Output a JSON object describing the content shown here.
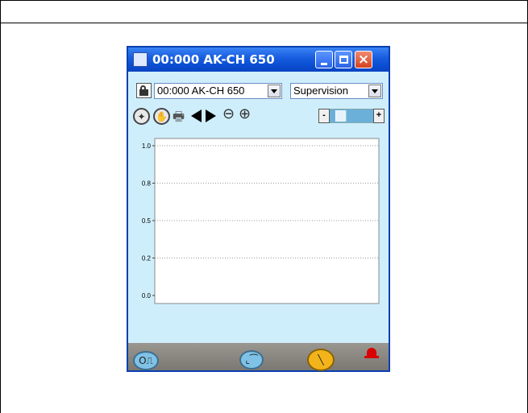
{
  "window": {
    "title": "00:000 AK-CH 650",
    "icon": "trend-window-icon",
    "controls": [
      "minimize-icon",
      "maximize-icon",
      "close-icon"
    ]
  },
  "selectors": {
    "device": {
      "value": "00:000 AK-CH 650"
    },
    "mode": {
      "value": "Supervision"
    }
  },
  "toolbar": {
    "icons": [
      "auto-scale-icon",
      "pan-icon",
      "print-icon",
      "previous-icon",
      "next-icon",
      "zoom-out-icon",
      "zoom-in-icon"
    ],
    "time_scroll": {
      "position": 0.2
    }
  },
  "chart_data": {
    "type": "line",
    "series": [],
    "y_ticks": [
      "1.0",
      "0.8",
      "0.5",
      "0.2",
      "0.0"
    ],
    "ylim": [
      0,
      1
    ],
    "grid": true,
    "grid_style": "dotted horizontal"
  },
  "bottom_bar": {
    "buttons": [
      "stop-icon",
      "trend-icon",
      "service-icon"
    ],
    "alarm": {
      "icon": "alarm-bell-icon",
      "color": "#d80000"
    }
  },
  "colors": {
    "window_bg": "#cfeefb",
    "titlebar": "#0b4fd4",
    "bottom_bar": "#8a8782",
    "service_button": "#f2b41a"
  }
}
